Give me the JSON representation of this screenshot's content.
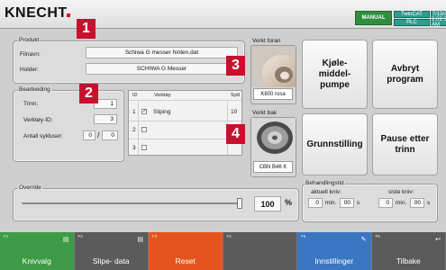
{
  "header": {
    "logo": "KNECHT",
    "mode": "MANUAL",
    "runtime": "TwinCAT",
    "plc": "PLC",
    "date": "7/13/2021",
    "time": "9:09:35 AM"
  },
  "produkt": {
    "title": "Produkt",
    "filnavn_label": "Filnavn:",
    "filnavn_value": "Schiwa G messer hinten.dat",
    "holder_label": "Holder:",
    "holder_value": "SCHIWA G Messer"
  },
  "bearbeiding": {
    "title": "Bearbeiding",
    "trinn_label": "Trinn:",
    "trinn_value": "1",
    "verktoy_label": "Verktøy-ID:",
    "verktoy_value": "3",
    "sykluser_label": "Antall sykluser:",
    "sykluser_done": "0",
    "sykluser_sep": "/",
    "sykluser_total": "0"
  },
  "tool_table": {
    "headers": [
      "ID",
      "Verktøy",
      "Sykl"
    ],
    "rows": [
      {
        "id": "1",
        "checked": true,
        "name": "Sliping",
        "cycles": "10"
      },
      {
        "id": "2",
        "checked": false,
        "name": "",
        "cycles": ""
      },
      {
        "id": "3",
        "checked": false,
        "name": "",
        "cycles": ""
      }
    ]
  },
  "tools": {
    "front_title": "Verkt foran",
    "front_name": "K800 rosa",
    "back_title": "Verkt bak",
    "back_name": "CBN B46 K"
  },
  "buttons": {
    "coolant": "Kjøle-middel-pumpe",
    "abort": "Avbryt program",
    "grind": "Grunnstilling",
    "pause": "Pause etter trinn"
  },
  "override": {
    "title": "Override",
    "value": "100",
    "unit": "%",
    "level": 1.0
  },
  "behandlingstid": {
    "title": "Behandlingstid",
    "current_label": "aktuell kniv:",
    "last_label": "siste kniv:",
    "current_min": "0",
    "current_sec": "00",
    "last_min": "0",
    "last_sec": "00",
    "min_label": "min.",
    "sec_label": "s"
  },
  "badges": [
    "1",
    "2",
    "3",
    "4"
  ],
  "fkeys": [
    {
      "num": "F1",
      "label": "Knivvalg",
      "color": "#3e9b45",
      "icon": "document-icon"
    },
    {
      "num": "F2",
      "label": "Slipe- data",
      "color": "#5b5b5b",
      "icon": "document-icon"
    },
    {
      "num": "F3",
      "label": "Reset",
      "color": "#e5541e",
      "icon": ""
    },
    {
      "num": "F4",
      "label": "",
      "color": "#5b5b5b",
      "icon": ""
    },
    {
      "num": "F5",
      "label": "Innstillinger",
      "color": "#3a76c2",
      "icon": "wrench-icon"
    },
    {
      "num": "F6",
      "label": "Tilbake",
      "color": "#5b5b5b",
      "icon": "back-arrow-icon"
    }
  ]
}
